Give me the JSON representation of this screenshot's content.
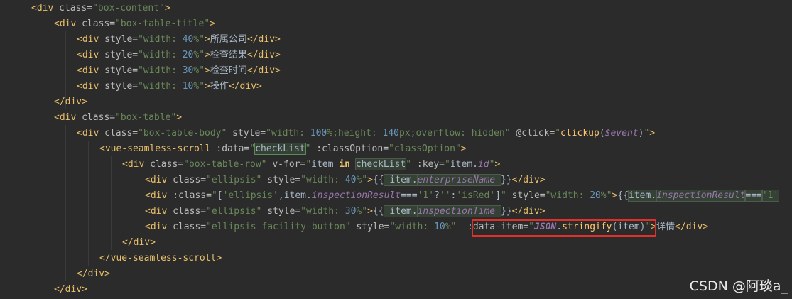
{
  "editor": {
    "lines": [
      {
        "indent": 44,
        "tokens": [
          {
            "c": "t-tag",
            "t": "<div "
          },
          {
            "c": "t-attr",
            "t": "class="
          },
          {
            "c": "t-val",
            "t": "\"box-content\""
          },
          {
            "c": "t-tag",
            "t": ">"
          }
        ]
      },
      {
        "indent": 76,
        "tokens": [
          {
            "c": "t-tag",
            "t": "<div "
          },
          {
            "c": "t-attr",
            "t": "class="
          },
          {
            "c": "t-val",
            "t": "\"box-table-title\""
          },
          {
            "c": "t-tag",
            "t": ">"
          }
        ]
      },
      {
        "indent": 108,
        "tokens": [
          {
            "c": "t-tag",
            "t": "<div "
          },
          {
            "c": "t-attr",
            "t": "style="
          },
          {
            "c": "t-val",
            "t": "\"width: "
          },
          {
            "c": "t-num",
            "t": "40"
          },
          {
            "c": "t-val",
            "t": "%\""
          },
          {
            "c": "t-tag",
            "t": ">"
          },
          {
            "c": "t-plain cjk",
            "t": "所属公司"
          },
          {
            "c": "t-tag",
            "t": "</div>"
          }
        ]
      },
      {
        "indent": 108,
        "tokens": [
          {
            "c": "t-tag",
            "t": "<div "
          },
          {
            "c": "t-attr",
            "t": "style="
          },
          {
            "c": "t-val",
            "t": "\"width: "
          },
          {
            "c": "t-num",
            "t": "20"
          },
          {
            "c": "t-val",
            "t": "%\""
          },
          {
            "c": "t-tag",
            "t": ">"
          },
          {
            "c": "t-plain cjk",
            "t": "检查结果"
          },
          {
            "c": "t-tag",
            "t": "</div>"
          }
        ]
      },
      {
        "indent": 108,
        "tokens": [
          {
            "c": "t-tag",
            "t": "<div "
          },
          {
            "c": "t-attr",
            "t": "style="
          },
          {
            "c": "t-val",
            "t": "\"width: "
          },
          {
            "c": "t-num",
            "t": "30"
          },
          {
            "c": "t-val",
            "t": "%\""
          },
          {
            "c": "t-tag",
            "t": ">"
          },
          {
            "c": "t-plain cjk",
            "t": "检查时间"
          },
          {
            "c": "t-tag",
            "t": "</div>"
          }
        ]
      },
      {
        "indent": 108,
        "tokens": [
          {
            "c": "t-tag",
            "t": "<div "
          },
          {
            "c": "t-attr",
            "t": "style="
          },
          {
            "c": "t-val",
            "t": "\"width: "
          },
          {
            "c": "t-num",
            "t": "10"
          },
          {
            "c": "t-val",
            "t": "%\""
          },
          {
            "c": "t-tag",
            "t": ">"
          },
          {
            "c": "t-plain cjk",
            "t": "操作"
          },
          {
            "c": "t-tag",
            "t": "</div>"
          }
        ]
      },
      {
        "indent": 76,
        "tokens": [
          {
            "c": "t-tag",
            "t": "</div>"
          }
        ]
      },
      {
        "indent": 76,
        "tokens": [
          {
            "c": "t-tag",
            "t": "<div "
          },
          {
            "c": "t-attr",
            "t": "class="
          },
          {
            "c": "t-val",
            "t": "\"box-table\""
          },
          {
            "c": "t-tag",
            "t": ">"
          }
        ]
      },
      {
        "indent": 108,
        "tokens": [
          {
            "c": "t-tag",
            "t": "<div "
          },
          {
            "c": "t-attr",
            "t": "class="
          },
          {
            "c": "t-val",
            "t": "\"box-table-body\" "
          },
          {
            "c": "t-attr",
            "t": "style="
          },
          {
            "c": "t-val",
            "t": "\"width: "
          },
          {
            "c": "t-num",
            "t": "100"
          },
          {
            "c": "t-val",
            "t": "%;height: "
          },
          {
            "c": "t-num",
            "t": "140"
          },
          {
            "c": "t-val",
            "t": "px;overflow: hidden\" "
          },
          {
            "c": "t-attr",
            "t": "@click="
          },
          {
            "c": "t-val",
            "t": "\""
          },
          {
            "c": "t-fn",
            "t": "clickup"
          },
          {
            "c": "t-plain",
            "t": "("
          },
          {
            "c": "t-var",
            "t": "$event"
          },
          {
            "c": "t-plain",
            "t": ")"
          },
          {
            "c": "t-val",
            "t": "\""
          },
          {
            "c": "t-tag",
            "t": ">"
          }
        ]
      },
      {
        "indent": 140,
        "tokens": [
          {
            "c": "t-tag",
            "t": "<vue-seamless-scroll "
          },
          {
            "c": "t-attr",
            "t": ":data="
          },
          {
            "c": "t-val",
            "t": "\""
          },
          {
            "c": "t-plain hl-box",
            "t": "checkList"
          },
          {
            "c": "t-val",
            "t": "\" "
          },
          {
            "c": "t-attr",
            "t": ":classOption="
          },
          {
            "c": "t-val",
            "t": "\"classOption\""
          },
          {
            "c": "t-tag",
            "t": ">"
          }
        ]
      },
      {
        "indent": 172,
        "tokens": [
          {
            "c": "t-tag",
            "t": "<div "
          },
          {
            "c": "t-attr",
            "t": "class="
          },
          {
            "c": "t-val",
            "t": "\"box-table-row\" "
          },
          {
            "c": "t-attr",
            "t": "v-for="
          },
          {
            "c": "t-val",
            "t": "\""
          },
          {
            "c": "t-plain",
            "t": "item "
          },
          {
            "c": "t-tag t-bold",
            "t": "in"
          },
          {
            "c": "t-plain",
            "t": " "
          },
          {
            "c": "t-plain hl",
            "t": "checkList"
          },
          {
            "c": "t-val",
            "t": "\" "
          },
          {
            "c": "t-attr",
            "t": ":key="
          },
          {
            "c": "t-val",
            "t": "\""
          },
          {
            "c": "t-plain",
            "t": "item."
          },
          {
            "c": "t-var",
            "t": "id"
          },
          {
            "c": "t-val",
            "t": "\""
          },
          {
            "c": "t-tag",
            "t": ">"
          }
        ]
      },
      {
        "indent": 204,
        "tokens": [
          {
            "c": "t-tag",
            "t": "<div "
          },
          {
            "c": "t-attr",
            "t": "class="
          },
          {
            "c": "t-val",
            "t": "\"ellipsis\" "
          },
          {
            "c": "t-attr",
            "t": "style="
          },
          {
            "c": "t-val",
            "t": "\"width: "
          },
          {
            "c": "t-num",
            "t": "40"
          },
          {
            "c": "t-val",
            "t": "%\""
          },
          {
            "c": "t-tag",
            "t": ">"
          },
          {
            "c": "t-plain",
            "t": "{{"
          },
          {
            "c": "t-plain hl",
            "t": " item."
          },
          {
            "c": "t-var hl",
            "t": "enterpriseName "
          },
          {
            "c": "t-plain",
            "t": "}}"
          },
          {
            "c": "t-tag",
            "t": "</div>"
          }
        ]
      },
      {
        "indent": 204,
        "tokens": [
          {
            "c": "t-tag",
            "t": "<div "
          },
          {
            "c": "t-attr",
            "t": ":class="
          },
          {
            "c": "t-val",
            "t": "\""
          },
          {
            "c": "t-plain",
            "t": "["
          },
          {
            "c": "t-val",
            "t": "'ellipsis'"
          },
          {
            "c": "t-plain",
            "t": ",item."
          },
          {
            "c": "t-var",
            "t": "inspectionResult"
          },
          {
            "c": "t-plain",
            "t": "==="
          },
          {
            "c": "t-val",
            "t": "'1'"
          },
          {
            "c": "t-plain",
            "t": "?"
          },
          {
            "c": "t-val",
            "t": "''"
          },
          {
            "c": "t-plain",
            "t": ":"
          },
          {
            "c": "t-val",
            "t": "'isRed'"
          },
          {
            "c": "t-plain",
            "t": "]"
          },
          {
            "c": "t-val",
            "t": "\" "
          },
          {
            "c": "t-attr",
            "t": "style="
          },
          {
            "c": "t-val",
            "t": "\"width: "
          },
          {
            "c": "t-num",
            "t": "20"
          },
          {
            "c": "t-val",
            "t": "%\""
          },
          {
            "c": "t-tag",
            "t": ">"
          },
          {
            "c": "t-plain",
            "t": "{{"
          },
          {
            "c": "t-plain hl",
            "t": "item."
          },
          {
            "c": "t-var hl",
            "t": "inspectionResult"
          },
          {
            "c": "t-plain hl",
            "t": "==="
          },
          {
            "c": "t-val hl",
            "t": "'1'"
          }
        ]
      },
      {
        "indent": 204,
        "tokens": [
          {
            "c": "t-tag",
            "t": "<div "
          },
          {
            "c": "t-attr",
            "t": "class="
          },
          {
            "c": "t-val",
            "t": "\"ellipsis\" "
          },
          {
            "c": "t-attr",
            "t": "style="
          },
          {
            "c": "t-val",
            "t": "\"width: "
          },
          {
            "c": "t-num",
            "t": "30"
          },
          {
            "c": "t-val",
            "t": "%\""
          },
          {
            "c": "t-tag",
            "t": ">"
          },
          {
            "c": "t-plain",
            "t": "{{"
          },
          {
            "c": "t-plain hl",
            "t": " item."
          },
          {
            "c": "t-var hl",
            "t": "inspectionTime "
          },
          {
            "c": "t-plain",
            "t": "}}"
          },
          {
            "c": "t-tag",
            "t": "</div>"
          }
        ]
      },
      {
        "indent": 204,
        "tokens": [
          {
            "c": "t-tag",
            "t": "<div "
          },
          {
            "c": "t-attr",
            "t": "class="
          },
          {
            "c": "t-val",
            "t": "\"ellipsis facility-button\" "
          },
          {
            "c": "t-attr",
            "t": "style="
          },
          {
            "c": "t-val",
            "t": "\"width: "
          },
          {
            "c": "t-num",
            "t": "10"
          },
          {
            "c": "t-val",
            "t": "%\"  "
          },
          {
            "c": "t-attr",
            "t": ":data-item="
          },
          {
            "c": "t-val",
            "t": "\""
          },
          {
            "c": "t-cls",
            "t": "JSON"
          },
          {
            "c": "t-plain",
            "t": "."
          },
          {
            "c": "t-fn",
            "t": "stringify"
          },
          {
            "c": "t-plain",
            "t": "(item)"
          },
          {
            "c": "t-val",
            "t": "\""
          },
          {
            "c": "t-tag",
            "t": ">"
          },
          {
            "c": "t-plain cjk",
            "t": "详情"
          },
          {
            "c": "t-tag",
            "t": "</div>"
          }
        ]
      },
      {
        "indent": 172,
        "tokens": [
          {
            "c": "t-tag",
            "t": "</div>"
          }
        ]
      },
      {
        "indent": 140,
        "tokens": [
          {
            "c": "t-tag",
            "t": "</vue-seamless-scroll>"
          }
        ]
      },
      {
        "indent": 108,
        "tokens": [
          {
            "c": "t-tag",
            "t": "</div>"
          }
        ]
      },
      {
        "indent": 76,
        "tokens": [
          {
            "c": "t-tag",
            "t": "</div>"
          }
        ]
      }
    ]
  },
  "watermark": "CSDN @阿琰a_",
  "colors": {
    "background": "#2b2b2b",
    "tag": "#e8bf6a",
    "string": "#6a8759",
    "number": "#6897bb",
    "property": "#9876aa",
    "function": "#ffc66d",
    "highlight_box": "#e0302a"
  }
}
